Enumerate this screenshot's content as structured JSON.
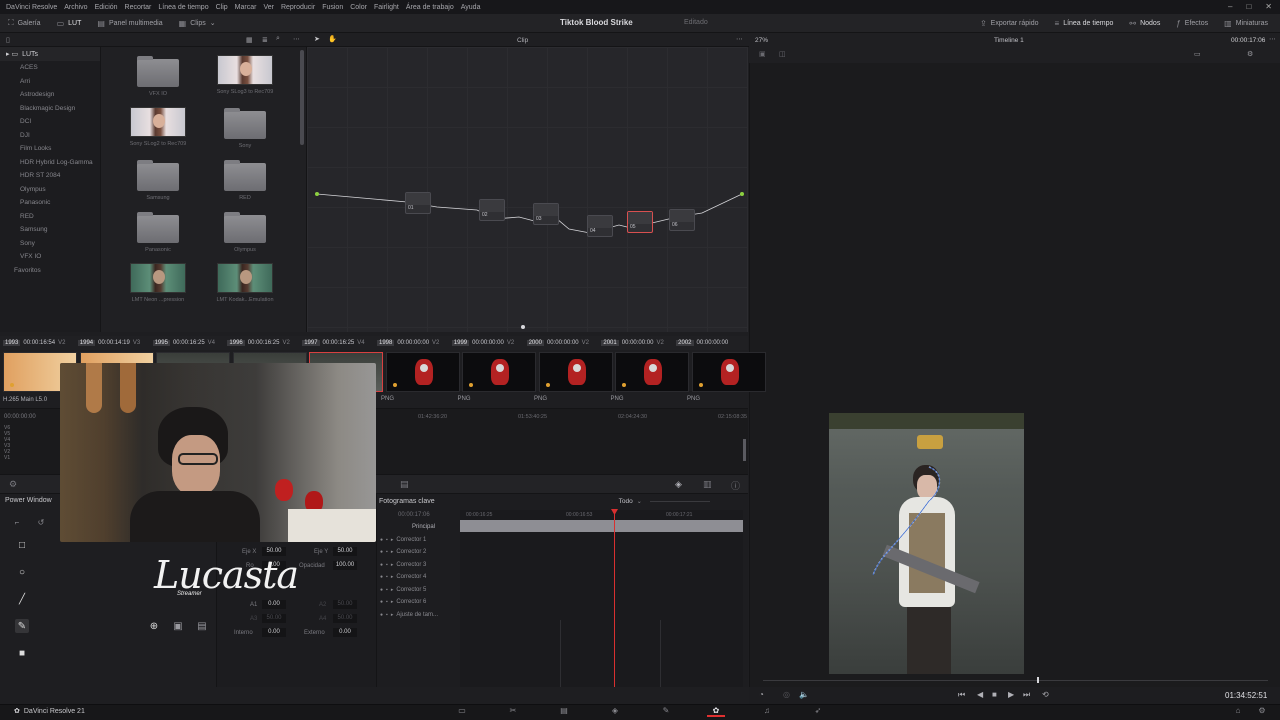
{
  "menu": [
    "DaVinci Resolve",
    "Archivo",
    "Edición",
    "Recortar",
    "Línea de tiempo",
    "Clip",
    "Marcar",
    "Ver",
    "Reproducir",
    "Fusion",
    "Color",
    "Fairlight",
    "Área de trabajo",
    "Ayuda"
  ],
  "toolbar": {
    "galeria": "Galería",
    "lut": "LUT",
    "panel": "Panel multimedia",
    "clips": "Clips",
    "project_title": "Tiktok Blood Strike",
    "project_status": "Editado",
    "exportar": "Exportar rápido",
    "linea": "Línea de tiempo",
    "nodos": "Nodos",
    "efectos": "Efectos",
    "miniaturas": "Miniaturas"
  },
  "row2": {
    "luts_label": "LUTs",
    "clip_mode": "Clip",
    "zoom": "27%",
    "timeline": "Timeline 1",
    "timecode": "00:00:17:06"
  },
  "lut_folders": [
    "ACES",
    "Arri",
    "Astrodesign",
    "Blackmagic Design",
    "DCI",
    "DJI",
    "Film Looks",
    "HDR Hybrid Log-Gamma",
    "HDR ST 2084",
    "Olympus",
    "Panasonic",
    "RED",
    "Samsung",
    "Sony",
    "VFX IO",
    "Favoritos"
  ],
  "lut_thumbs": [
    {
      "label": "VFX IO",
      "kind": "folder"
    },
    {
      "label": "Sony SLog3 to Rec709",
      "kind": "photo"
    },
    {
      "label": "Sony SLog2 to Rec709",
      "kind": "photo"
    },
    {
      "label": "Sony",
      "kind": "folder"
    },
    {
      "label": "Samsung",
      "kind": "folder"
    },
    {
      "label": "RED",
      "kind": "folder"
    },
    {
      "label": "Panasonic",
      "kind": "folder"
    },
    {
      "label": "Olympus",
      "kind": "folder"
    },
    {
      "label": "LMT Neon ...pression",
      "kind": "photo-green"
    },
    {
      "label": "LMT Kodak...Emulation",
      "kind": "photo-green"
    }
  ],
  "nodes": [
    "01",
    "02",
    "03",
    "04",
    "05",
    "06"
  ],
  "clips_header": [
    {
      "num": "1993",
      "tc": "00:00:16:54",
      "track": "V2"
    },
    {
      "num": "1994",
      "tc": "00:00:14:19",
      "track": "V3"
    },
    {
      "num": "1995",
      "tc": "00:00:16:25",
      "track": "V4"
    },
    {
      "num": "1996",
      "tc": "00:00:16:25",
      "track": "V2"
    },
    {
      "num": "1997",
      "tc": "00:00:16:25",
      "track": "V4"
    },
    {
      "num": "1998",
      "tc": "00:00:00:00",
      "track": "V2"
    },
    {
      "num": "1999",
      "tc": "00:00:00:00",
      "track": "V2"
    },
    {
      "num": "2000",
      "tc": "00:00:00:00",
      "track": "V2"
    },
    {
      "num": "2001",
      "tc": "00:00:00:00",
      "track": "V2"
    },
    {
      "num": "2002",
      "tc": "00:00:00:00",
      "track": ""
    }
  ],
  "clip_codec": "H.265 Main L5.0",
  "clip_format": "PNG",
  "mini_tl": {
    "tc0": "00:00:00:00",
    "tc1": "01:42:36:20",
    "tc2": "01:53:40:25",
    "tc3": "02:04:24:30",
    "tc4": "02:15:08:35",
    "tracks": [
      "V6",
      "V5",
      "V4",
      "V3",
      "V2",
      "V1"
    ]
  },
  "power_window": {
    "title": "Power Window",
    "eje_x_label": "Eje X",
    "eje_x": "50.00",
    "eje_y_label": "Eje Y",
    "eje_y": "50.00",
    "rot_label": "Ro",
    "rot": "0.00",
    "opac_label": "Opacidad",
    "opac": "100.00",
    "a1_label": "A1",
    "a1": "0.00",
    "a2_label": "A2",
    "a2": "50.00",
    "a3_label": "A3",
    "a3": "50.00",
    "a4_label": "A4",
    "a4": "50.00",
    "interno_label": "Interno",
    "interno": "0.00",
    "externo_label": "Externo",
    "externo": "0.00"
  },
  "keyframes": {
    "title": "Fotogramas clave",
    "filter": "Todo",
    "current_tc": "00:00:17:06",
    "ruler": [
      "00:00:16:25",
      "00:00:16:53",
      "00:00:17:21"
    ],
    "rows": [
      "Principal",
      "Corrector 1",
      "Corrector 2",
      "Corrector 3",
      "Corrector 4",
      "Corrector 5",
      "Corrector 6",
      "Ajuste de tam..."
    ]
  },
  "viewer": {
    "timecode": "01:34:52:51"
  },
  "app_name": "DaVinci Resolve 21",
  "overlay": {
    "brand": "Lucasta",
    "brand_sub": "Streamer"
  }
}
